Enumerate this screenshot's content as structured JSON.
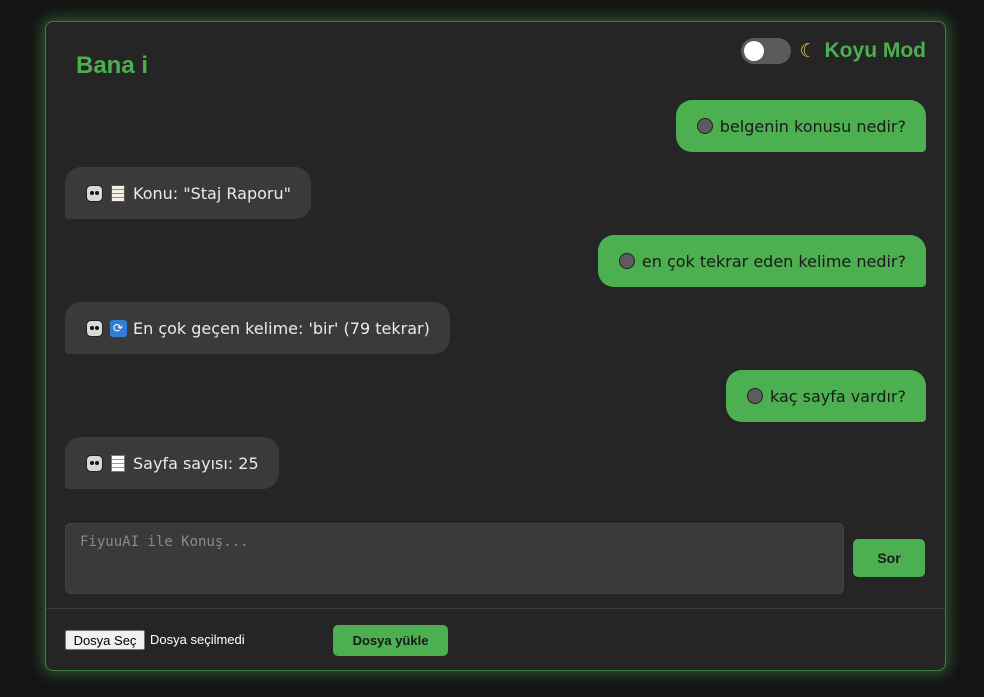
{
  "header": {
    "title": "Bana i",
    "dark_mode_label": "Koyu Mod",
    "dark_mode_icon": "moon-icon",
    "dark_mode_on": false
  },
  "messages": [
    {
      "role": "user",
      "icon": "user-avatar-icon",
      "text": "belgenin konusu nedir?"
    },
    {
      "role": "bot",
      "icon": "robot-icon",
      "text_icon": "memo-icon",
      "text": "Konu: \"Staj Raporu\""
    },
    {
      "role": "user",
      "icon": "user-avatar-icon",
      "text": "en çok tekrar eden kelime nedir?"
    },
    {
      "role": "bot",
      "icon": "robot-icon",
      "text_icon": "repeat-icon",
      "text": "En çok geçen kelime: 'bir' (79 tekrar)"
    },
    {
      "role": "user",
      "icon": "user-avatar-icon",
      "text": "kaç sayfa vardır?"
    },
    {
      "role": "bot",
      "icon": "robot-icon",
      "text_icon": "page-icon",
      "text": "Sayfa sayısı: 25"
    }
  ],
  "composer": {
    "placeholder": "FiyuuAI ile Konuş...",
    "value": "",
    "send_label": "Sor"
  },
  "upload": {
    "choose_label": "Dosya Seç",
    "status": "Dosya seçilmedi",
    "upload_label": "Dosya yükle"
  },
  "colors": {
    "accent": "#4caf50",
    "panel_bg": "#252525",
    "page_bg": "#141414",
    "bot_bubble": "#3a3a3a"
  }
}
